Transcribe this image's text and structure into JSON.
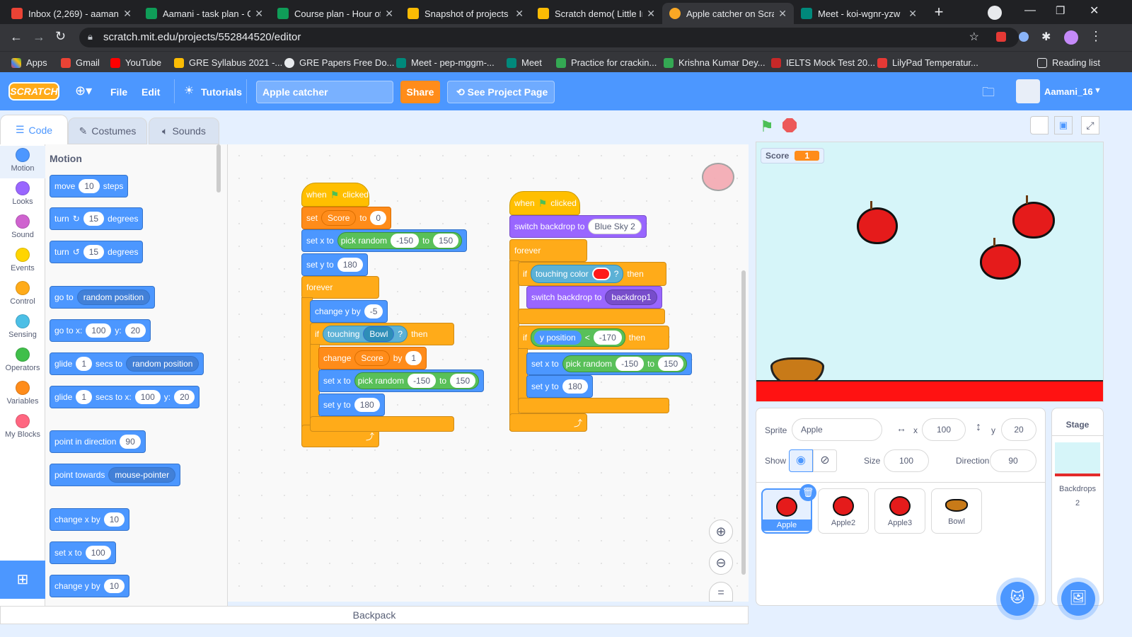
{
  "browser": {
    "tabs": [
      {
        "title": "Inbox (2,269) - aaman",
        "color": "#ea4335"
      },
      {
        "title": "Aamani - task plan - G",
        "color": "#0f9d58"
      },
      {
        "title": "Course plan - Hour of",
        "color": "#0f9d58"
      },
      {
        "title": "Snapshot of projects -",
        "color": "#fbbc04"
      },
      {
        "title": "Scratch demo( Little Ir",
        "color": "#fbbc04"
      },
      {
        "title": "Apple catcher on Scra",
        "color": "#f9a825"
      },
      {
        "title": "Meet - koi-wgnr-yzw",
        "color": "#00897b"
      }
    ],
    "url": "scratch.mit.edu/projects/552844520/editor",
    "bookmarks": [
      "Apps",
      "Gmail",
      "YouTube",
      "GRE Syllabus 2021 -...",
      "GRE Papers Free Do...",
      "Meet - pep-mggm-...",
      "Meet",
      "Practice for crackin...",
      "Krishna Kumar Dey...",
      "IELTS Mock Test 20...",
      "LilyPad Temperatur..."
    ],
    "reading_list": "Reading list"
  },
  "menu": {
    "logo": "SCRATCH",
    "file": "File",
    "edit": "Edit",
    "tutorials": "Tutorials",
    "project_title": "Apple catcher",
    "share": "Share",
    "see_project": "See Project Page",
    "username": "Aamani_16"
  },
  "editor_tabs": {
    "code": "Code",
    "costumes": "Costumes",
    "sounds": "Sounds"
  },
  "categories": [
    {
      "label": "Motion",
      "color": "#4c97ff"
    },
    {
      "label": "Looks",
      "color": "#9966ff"
    },
    {
      "label": "Sound",
      "color": "#cf63cf"
    },
    {
      "label": "Events",
      "color": "#ffd500"
    },
    {
      "label": "Control",
      "color": "#ffab19"
    },
    {
      "label": "Sensing",
      "color": "#4cbfe6"
    },
    {
      "label": "Operators",
      "color": "#40bf4a"
    },
    {
      "label": "Variables",
      "color": "#ff8c1a"
    },
    {
      "label": "My Blocks",
      "color": "#ff6680"
    }
  ],
  "palette": {
    "heading": "Motion",
    "move": {
      "a": "move",
      "v": "10",
      "b": "steps"
    },
    "turn_r": {
      "a": "turn",
      "v": "15",
      "b": "degrees"
    },
    "turn_l": {
      "a": "turn",
      "v": "15",
      "b": "degrees"
    },
    "goto": {
      "a": "go to",
      "d": "random position"
    },
    "gotoxy": {
      "a": "go to x:",
      "x": "100",
      "b": "y:",
      "y": "20"
    },
    "glide1": {
      "a": "glide",
      "v": "1",
      "b": "secs to",
      "d": "random position"
    },
    "glide2": {
      "a": "glide",
      "v": "1",
      "b": "secs to x:",
      "x": "100",
      "c": "y:",
      "y": "20"
    },
    "point_dir": {
      "a": "point in direction",
      "v": "90"
    },
    "point_towards": {
      "a": "point towards",
      "d": "mouse-pointer"
    },
    "change_x": {
      "a": "change x by",
      "v": "10"
    },
    "set_x": {
      "a": "set x to",
      "v": "100"
    },
    "change_y": {
      "a": "change y by",
      "v": "10"
    }
  },
  "script1": {
    "hat": {
      "a": "when",
      "b": "clicked"
    },
    "set_var": {
      "a": "set",
      "var": "Score",
      "b": "to",
      "v": "0"
    },
    "setx": {
      "a": "set x to",
      "op": "pick random",
      "lo": "-150",
      "to": "to",
      "hi": "150"
    },
    "sety": {
      "a": "set y to",
      "v": "180"
    },
    "forever": "forever",
    "changey": {
      "a": "change y by",
      "v": "-5"
    },
    "if": {
      "a": "if",
      "touch": "touching",
      "obj": "Bowl",
      "q": "?",
      "then": "then"
    },
    "change_var": {
      "a": "change",
      "var": "Score",
      "b": "by",
      "v": "1"
    },
    "setx2": {
      "a": "set x to",
      "op": "pick random",
      "lo": "-150",
      "to": "to",
      "hi": "150"
    },
    "sety2": {
      "a": "set y to",
      "v": "180"
    }
  },
  "script2": {
    "hat": {
      "a": "when",
      "b": "clicked"
    },
    "switch1": {
      "a": "switch backdrop to",
      "d": "Blue Sky 2"
    },
    "forever": "forever",
    "if1": {
      "a": "if",
      "touch": "touching color",
      "q": "?",
      "then": "then",
      "color": "#ff1a1a"
    },
    "switch2": {
      "a": "switch backdrop to",
      "d": "backdrop1"
    },
    "if2": {
      "a": "if",
      "op": "y position",
      "lt": "<",
      "v": "-170",
      "then": "then"
    },
    "setx": {
      "a": "set x to",
      "op": "pick random",
      "lo": "-150",
      "to": "to",
      "hi": "150"
    },
    "sety": {
      "a": "set y to",
      "v": "180"
    }
  },
  "backpack": "Backpack",
  "stage": {
    "monitor_label": "Score",
    "monitor_value": "1"
  },
  "sprite_info": {
    "sprite_label": "Sprite",
    "sprite_name": "Apple",
    "x_label": "x",
    "x": "100",
    "y_label": "y",
    "y": "20",
    "show_label": "Show",
    "size_label": "Size",
    "size": "100",
    "direction_label": "Direction",
    "direction": "90"
  },
  "sprites": [
    "Apple",
    "Apple2",
    "Apple3",
    "Bowl"
  ],
  "stage_panel": {
    "title": "Stage",
    "backdrops_label": "Backdrops",
    "backdrops_count": "2"
  }
}
